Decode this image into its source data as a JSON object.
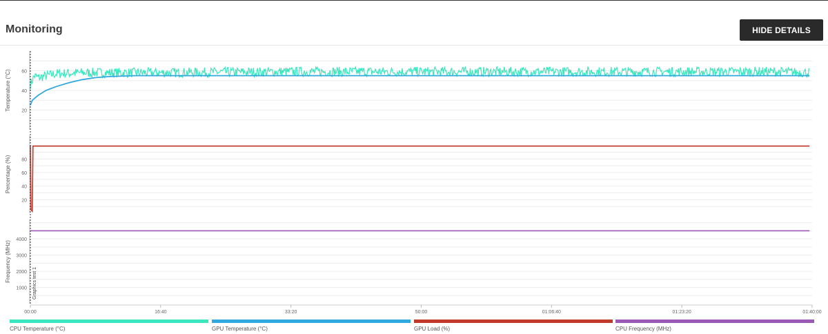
{
  "header": {
    "title": "Monitoring",
    "hide_details_label": "HIDE DETAILS"
  },
  "chart_data": {
    "type": "line",
    "x_ticks": [
      "00:00",
      "16:40",
      "33:20",
      "50:00",
      "01:06:40",
      "01:23:20",
      "01:40:00"
    ],
    "x_tick_seconds": [
      0,
      1000,
      2000,
      3000,
      4000,
      5000,
      6000
    ],
    "xlim": [
      0,
      6000
    ],
    "marker": {
      "x": 0,
      "label": "Graphics test 1"
    },
    "grid": true,
    "legend_position": "bottom",
    "series": [
      {
        "name": "CPU Temperature (°C)",
        "color": "#3ae6bd",
        "panel": 0,
        "x": [
          0,
          30,
          60,
          200,
          400,
          1000,
          2000,
          3000,
          4000,
          5000,
          5700,
          5980
        ],
        "y": [
          46,
          55,
          53,
          57,
          58,
          58,
          59,
          59,
          59,
          59,
          59,
          58
        ]
      },
      {
        "name": "GPU Temperature (°C)",
        "color": "#2fa9de",
        "panel": 0,
        "x": [
          0,
          15,
          60,
          120,
          200,
          300,
          400,
          500,
          600,
          800,
          1000,
          1500,
          2000,
          3000,
          4000,
          5000,
          5980
        ],
        "y": [
          25,
          30,
          35,
          40,
          44,
          48,
          51,
          53,
          54,
          55,
          55,
          55,
          55,
          55,
          55,
          55,
          55
        ]
      },
      {
        "name": "GPU Load (%)",
        "color": "#c0392b",
        "panel": 1,
        "x": [
          0,
          5,
          15,
          20,
          30,
          5980
        ],
        "y": [
          100,
          5,
          3,
          99,
          99,
          99
        ]
      },
      {
        "name": "CPU Frequency (MHz)",
        "color": "#9b59b6",
        "panel": 2,
        "x": [
          0,
          5980
        ],
        "y": [
          4500,
          4500
        ]
      }
    ],
    "panels": [
      {
        "ylabel": "Temperature (°C)",
        "ylim": [
          0,
          80
        ],
        "yticks": [
          20,
          40,
          60
        ]
      },
      {
        "ylabel": "Percentage (%)",
        "ylim": [
          0,
          115
        ],
        "yticks": [
          20,
          40,
          60,
          80
        ]
      },
      {
        "ylabel": "Frequency (MHz)",
        "ylim": [
          0,
          5200
        ],
        "yticks": [
          1000,
          2000,
          3000,
          4000
        ]
      }
    ]
  }
}
